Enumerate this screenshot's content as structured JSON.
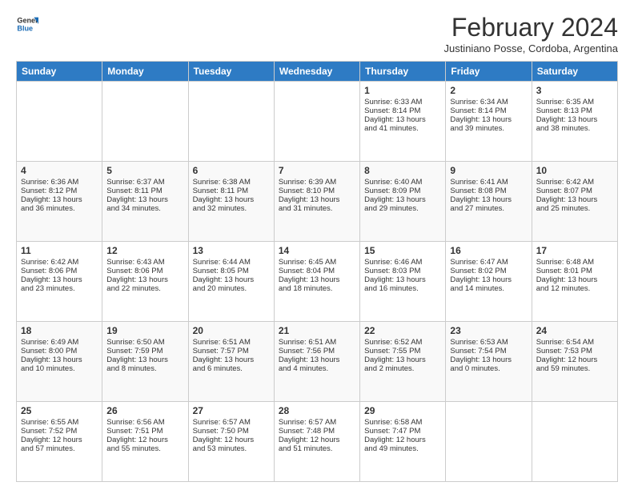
{
  "logo": {
    "line1": "General",
    "line2": "Blue"
  },
  "title": "February 2024",
  "location": "Justiniano Posse, Cordoba, Argentina",
  "days_header": [
    "Sunday",
    "Monday",
    "Tuesday",
    "Wednesday",
    "Thursday",
    "Friday",
    "Saturday"
  ],
  "weeks": [
    [
      {
        "day": "",
        "info": ""
      },
      {
        "day": "",
        "info": ""
      },
      {
        "day": "",
        "info": ""
      },
      {
        "day": "",
        "info": ""
      },
      {
        "day": "1",
        "info": "Sunrise: 6:33 AM\nSunset: 8:14 PM\nDaylight: 13 hours\nand 41 minutes."
      },
      {
        "day": "2",
        "info": "Sunrise: 6:34 AM\nSunset: 8:14 PM\nDaylight: 13 hours\nand 39 minutes."
      },
      {
        "day": "3",
        "info": "Sunrise: 6:35 AM\nSunset: 8:13 PM\nDaylight: 13 hours\nand 38 minutes."
      }
    ],
    [
      {
        "day": "4",
        "info": "Sunrise: 6:36 AM\nSunset: 8:12 PM\nDaylight: 13 hours\nand 36 minutes."
      },
      {
        "day": "5",
        "info": "Sunrise: 6:37 AM\nSunset: 8:11 PM\nDaylight: 13 hours\nand 34 minutes."
      },
      {
        "day": "6",
        "info": "Sunrise: 6:38 AM\nSunset: 8:11 PM\nDaylight: 13 hours\nand 32 minutes."
      },
      {
        "day": "7",
        "info": "Sunrise: 6:39 AM\nSunset: 8:10 PM\nDaylight: 13 hours\nand 31 minutes."
      },
      {
        "day": "8",
        "info": "Sunrise: 6:40 AM\nSunset: 8:09 PM\nDaylight: 13 hours\nand 29 minutes."
      },
      {
        "day": "9",
        "info": "Sunrise: 6:41 AM\nSunset: 8:08 PM\nDaylight: 13 hours\nand 27 minutes."
      },
      {
        "day": "10",
        "info": "Sunrise: 6:42 AM\nSunset: 8:07 PM\nDaylight: 13 hours\nand 25 minutes."
      }
    ],
    [
      {
        "day": "11",
        "info": "Sunrise: 6:42 AM\nSunset: 8:06 PM\nDaylight: 13 hours\nand 23 minutes."
      },
      {
        "day": "12",
        "info": "Sunrise: 6:43 AM\nSunset: 8:06 PM\nDaylight: 13 hours\nand 22 minutes."
      },
      {
        "day": "13",
        "info": "Sunrise: 6:44 AM\nSunset: 8:05 PM\nDaylight: 13 hours\nand 20 minutes."
      },
      {
        "day": "14",
        "info": "Sunrise: 6:45 AM\nSunset: 8:04 PM\nDaylight: 13 hours\nand 18 minutes."
      },
      {
        "day": "15",
        "info": "Sunrise: 6:46 AM\nSunset: 8:03 PM\nDaylight: 13 hours\nand 16 minutes."
      },
      {
        "day": "16",
        "info": "Sunrise: 6:47 AM\nSunset: 8:02 PM\nDaylight: 13 hours\nand 14 minutes."
      },
      {
        "day": "17",
        "info": "Sunrise: 6:48 AM\nSunset: 8:01 PM\nDaylight: 13 hours\nand 12 minutes."
      }
    ],
    [
      {
        "day": "18",
        "info": "Sunrise: 6:49 AM\nSunset: 8:00 PM\nDaylight: 13 hours\nand 10 minutes."
      },
      {
        "day": "19",
        "info": "Sunrise: 6:50 AM\nSunset: 7:59 PM\nDaylight: 13 hours\nand 8 minutes."
      },
      {
        "day": "20",
        "info": "Sunrise: 6:51 AM\nSunset: 7:57 PM\nDaylight: 13 hours\nand 6 minutes."
      },
      {
        "day": "21",
        "info": "Sunrise: 6:51 AM\nSunset: 7:56 PM\nDaylight: 13 hours\nand 4 minutes."
      },
      {
        "day": "22",
        "info": "Sunrise: 6:52 AM\nSunset: 7:55 PM\nDaylight: 13 hours\nand 2 minutes."
      },
      {
        "day": "23",
        "info": "Sunrise: 6:53 AM\nSunset: 7:54 PM\nDaylight: 13 hours\nand 0 minutes."
      },
      {
        "day": "24",
        "info": "Sunrise: 6:54 AM\nSunset: 7:53 PM\nDaylight: 12 hours\nand 59 minutes."
      }
    ],
    [
      {
        "day": "25",
        "info": "Sunrise: 6:55 AM\nSunset: 7:52 PM\nDaylight: 12 hours\nand 57 minutes."
      },
      {
        "day": "26",
        "info": "Sunrise: 6:56 AM\nSunset: 7:51 PM\nDaylight: 12 hours\nand 55 minutes."
      },
      {
        "day": "27",
        "info": "Sunrise: 6:57 AM\nSunset: 7:50 PM\nDaylight: 12 hours\nand 53 minutes."
      },
      {
        "day": "28",
        "info": "Sunrise: 6:57 AM\nSunset: 7:48 PM\nDaylight: 12 hours\nand 51 minutes."
      },
      {
        "day": "29",
        "info": "Sunrise: 6:58 AM\nSunset: 7:47 PM\nDaylight: 12 hours\nand 49 minutes."
      },
      {
        "day": "",
        "info": ""
      },
      {
        "day": "",
        "info": ""
      }
    ]
  ]
}
